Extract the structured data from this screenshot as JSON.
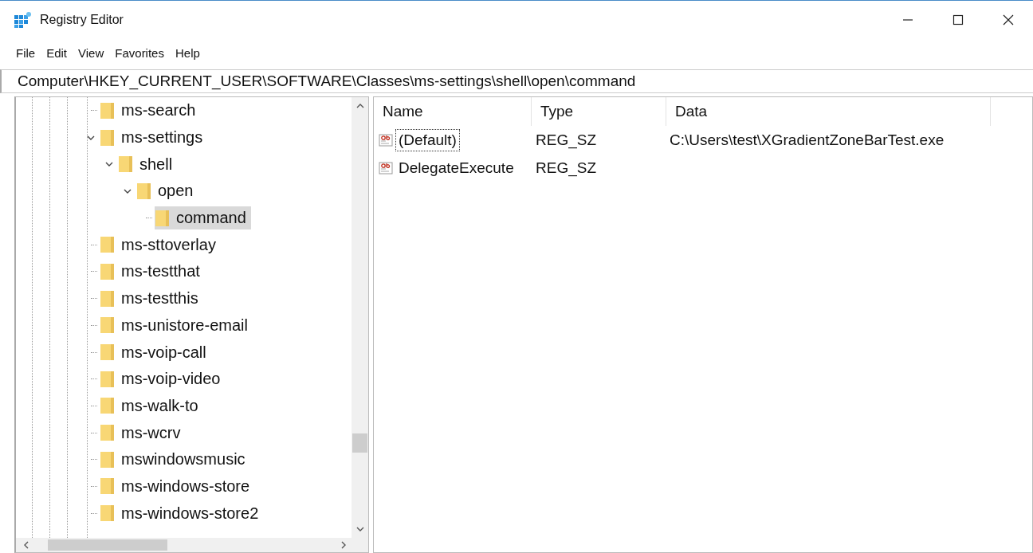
{
  "window": {
    "title": "Registry Editor"
  },
  "menu": [
    "File",
    "Edit",
    "View",
    "Favorites",
    "Help"
  ],
  "address": "Computer\\HKEY_CURRENT_USER\\SOFTWARE\\Classes\\ms-settings\\shell\\open\\command",
  "tree": [
    {
      "label": "ms-search",
      "selected": false
    },
    {
      "label": "ms-settings",
      "selected": false,
      "expanded": true,
      "children": [
        {
          "label": "shell",
          "selected": false,
          "expanded": true,
          "children": [
            {
              "label": "open",
              "selected": false,
              "expanded": true,
              "children": [
                {
                  "label": "command",
                  "selected": true
                }
              ]
            }
          ]
        }
      ]
    },
    {
      "label": "ms-sttoverlay",
      "selected": false
    },
    {
      "label": "ms-testthat",
      "selected": false
    },
    {
      "label": "ms-testthis",
      "selected": false
    },
    {
      "label": "ms-unistore-email",
      "selected": false
    },
    {
      "label": "ms-voip-call",
      "selected": false
    },
    {
      "label": "ms-voip-video",
      "selected": false
    },
    {
      "label": "ms-walk-to",
      "selected": false
    },
    {
      "label": "ms-wcrv",
      "selected": false
    },
    {
      "label": "mswindowsmusic",
      "selected": false
    },
    {
      "label": "ms-windows-store",
      "selected": false
    },
    {
      "label": "ms-windows-store2",
      "selected": false
    }
  ],
  "values": {
    "columns": [
      "Name",
      "Type",
      "Data"
    ],
    "rows": [
      {
        "name": "(Default)",
        "type": "REG_SZ",
        "data": "C:\\Users\\test\\XGradientZoneBarTest.exe",
        "selected": true
      },
      {
        "name": "DelegateExecute",
        "type": "REG_SZ",
        "selected": false
      }
    ]
  }
}
